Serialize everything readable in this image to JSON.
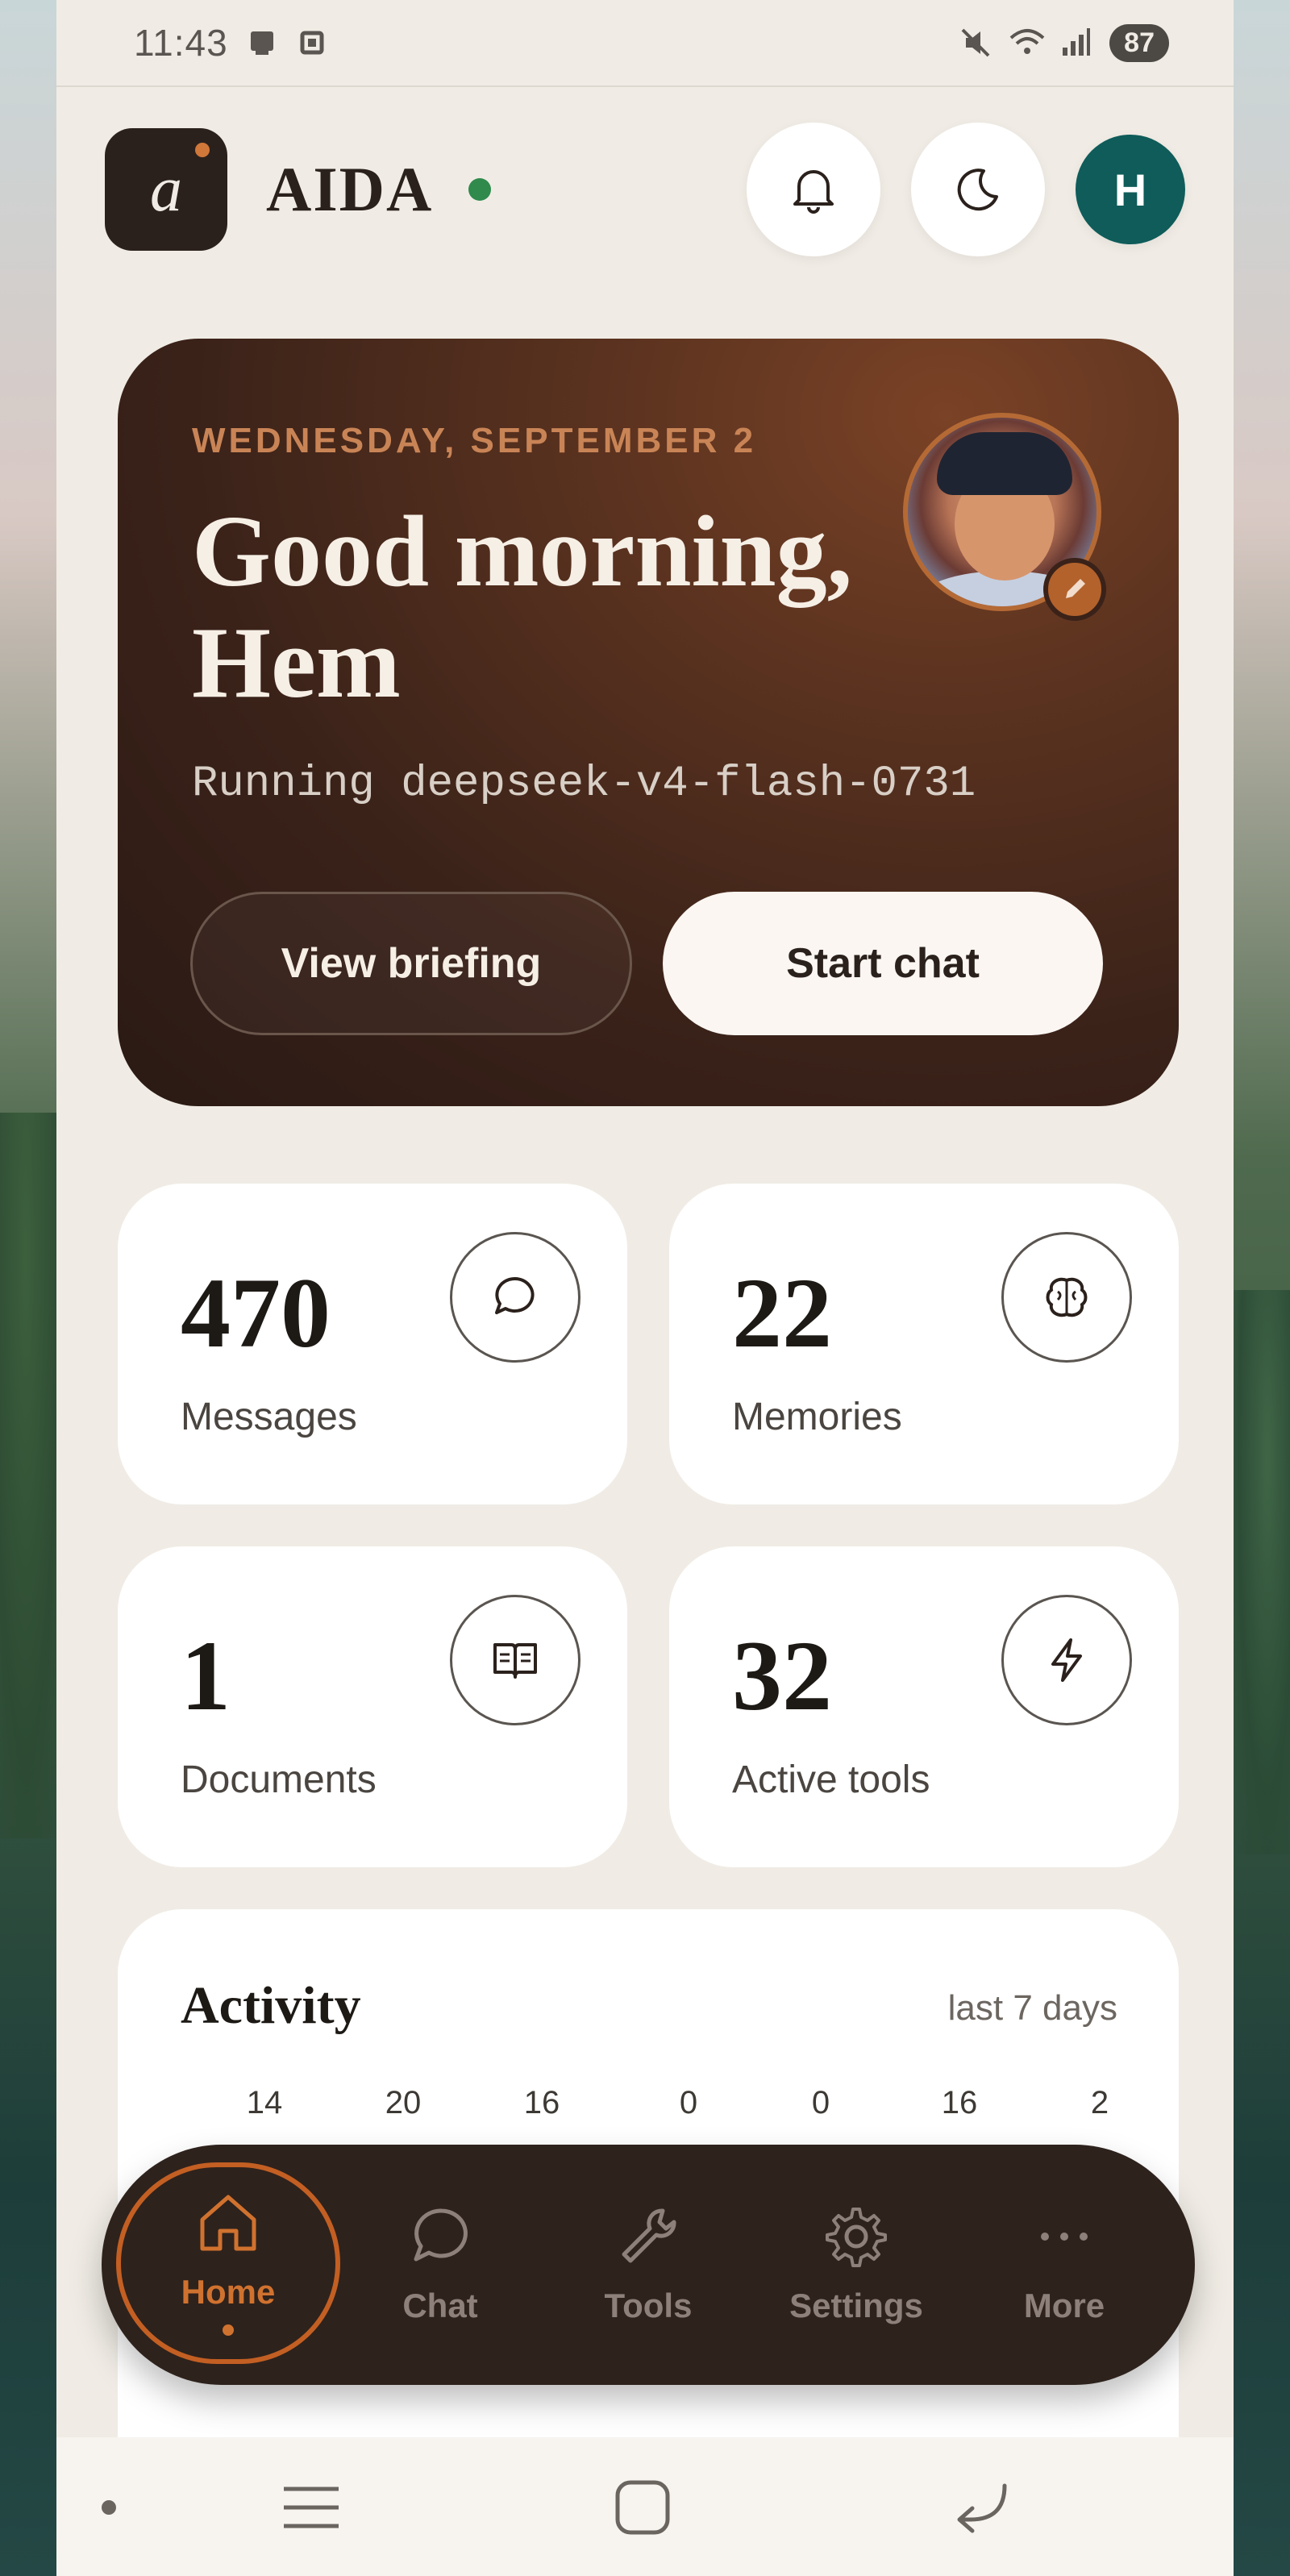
{
  "status_bar": {
    "time": "11:43",
    "battery": "87"
  },
  "header": {
    "logo_letter": "a",
    "app_name": "AIDA",
    "avatar_initial": "H"
  },
  "hero": {
    "date": "WEDNESDAY, SEPTEMBER 2",
    "greeting": "Good morning, Hem",
    "model_line": "Running deepseek-v4-flash-0731",
    "view_briefing_label": "View briefing",
    "start_chat_label": "Start chat"
  },
  "stats": [
    {
      "value": "470",
      "label": "Messages",
      "icon": "chat-bubble-icon"
    },
    {
      "value": "22",
      "label": "Memories",
      "icon": "brain-icon"
    },
    {
      "value": "1",
      "label": "Documents",
      "icon": "book-icon"
    },
    {
      "value": "32",
      "label": "Active tools",
      "icon": "lightning-icon"
    }
  ],
  "activity": {
    "title": "Activity",
    "range": "last 7 days",
    "values": [
      "14",
      "20",
      "16",
      "0",
      "0",
      "16",
      "2"
    ]
  },
  "nav": {
    "items": [
      {
        "label": "Home",
        "icon": "home-icon",
        "active": true
      },
      {
        "label": "Chat",
        "icon": "chat-icon",
        "active": false
      },
      {
        "label": "Tools",
        "icon": "wrench-icon",
        "active": false
      },
      {
        "label": "Settings",
        "icon": "gear-icon",
        "active": false
      },
      {
        "label": "More",
        "icon": "more-icon",
        "active": false
      }
    ]
  },
  "colors": {
    "accent": "#d0722f",
    "online": "#2f8a4c",
    "hero_dark": "#2a1914",
    "avatar": "#0f5c5a"
  }
}
